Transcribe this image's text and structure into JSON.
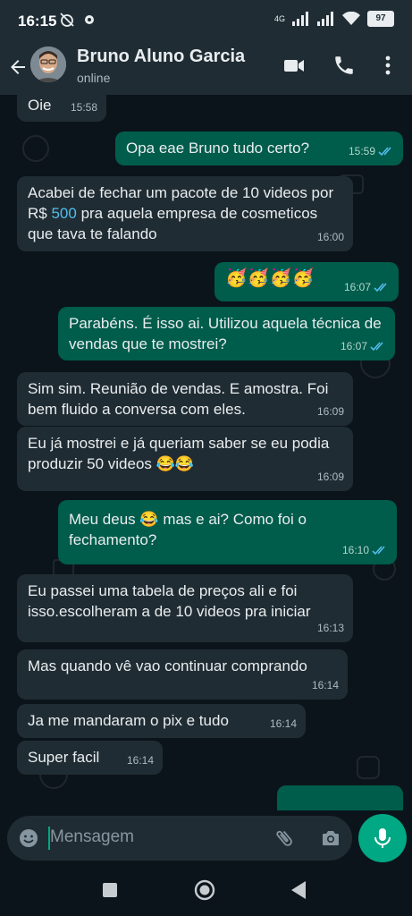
{
  "status_bar": {
    "time": "16:15",
    "network": "4G",
    "battery": "97"
  },
  "header": {
    "contact_name": "Bruno Aluno Garcia",
    "contact_status": "online"
  },
  "messages": [
    {
      "dir": "in",
      "text": "Oie",
      "time": "15:58"
    },
    {
      "dir": "out",
      "text": "Opa eae Bruno tudo certo?",
      "time": "15:59",
      "read": true
    },
    {
      "dir": "in",
      "text_before": "Acabei de fechar um pacote de 10 videos por R$ ",
      "link": "500",
      "text_after": " pra aquela empresa de cosmeticos que tava te falando",
      "time": "16:00"
    },
    {
      "dir": "out",
      "emoji": "🥳🥳🥳🥳",
      "time": "16:07",
      "read": true
    },
    {
      "dir": "out",
      "text": "Parabéns. É isso ai. Utilizou aquela técnica de vendas que te mostrei?",
      "time": "16:07",
      "read": true
    },
    {
      "dir": "in",
      "text": "Sim sim. Reunião de vendas. E amostra. Foi bem fluido a conversa com eles.",
      "time": "16:09"
    },
    {
      "dir": "in",
      "text": "Eu já mostrei e já queriam saber se eu podia produzir 50 videos",
      "emoji": "😂😂",
      "time": "16:09"
    },
    {
      "dir": "out",
      "text_before": "Meu deus",
      "emoji": "😂",
      "text_after": "mas e ai? Como foi o fechamento?",
      "time": "16:10",
      "read": true
    },
    {
      "dir": "in",
      "text": "Eu passei uma tabela de preços ali e foi isso.escolheram a de 10 videos pra iniciar",
      "time": "16:13"
    },
    {
      "dir": "in",
      "text": "Mas quando vê vao continuar comprando",
      "time": "16:14"
    },
    {
      "dir": "in",
      "text": "Ja me mandaram o pix e tudo",
      "time": "16:14"
    },
    {
      "dir": "in",
      "text": "Super facil",
      "time": "16:14"
    }
  ],
  "composer": {
    "placeholder": "Mensagem"
  },
  "colors": {
    "incoming": "#202c33",
    "outgoing": "#005c4b",
    "accent": "#00a884",
    "read_ticks": "#53bdeb"
  },
  "icons": [
    "back-arrow-icon",
    "video-call-icon",
    "voice-call-icon",
    "more-icon",
    "emoji-icon",
    "attach-icon",
    "camera-icon",
    "mic-icon",
    "nav-square-icon",
    "nav-home-icon",
    "nav-back-icon"
  ]
}
